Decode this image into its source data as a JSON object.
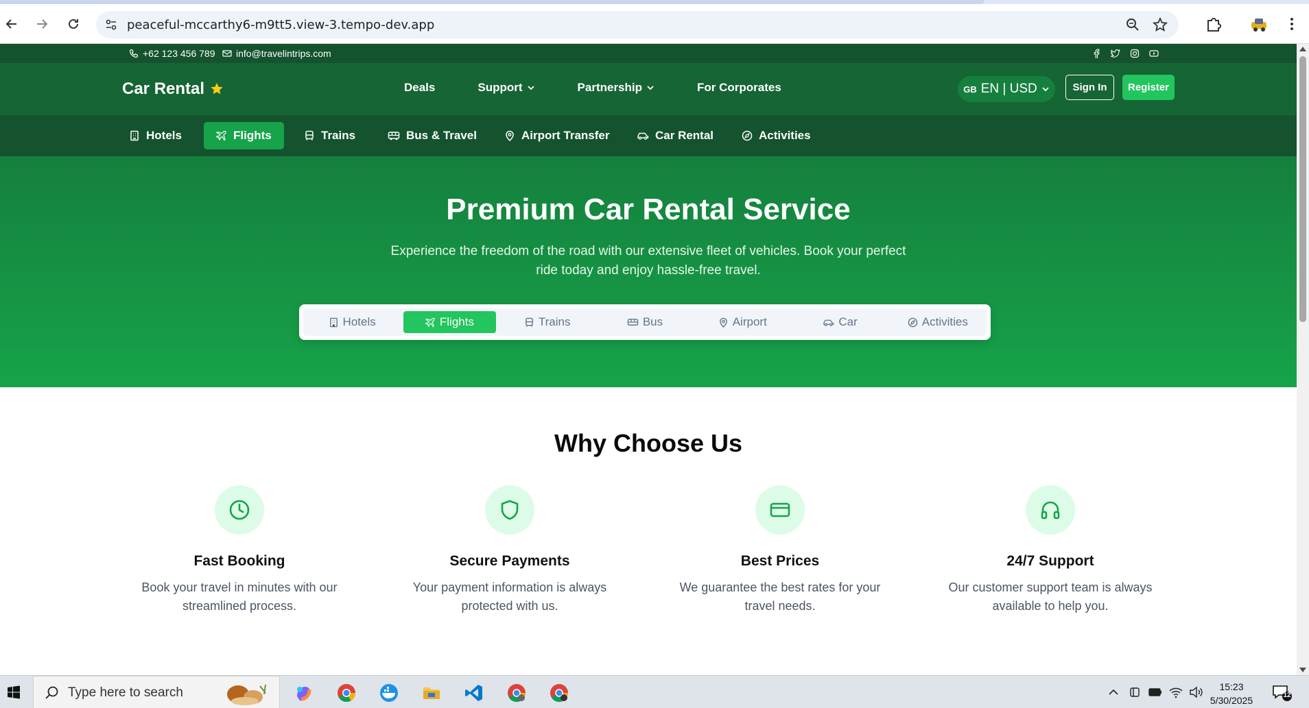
{
  "browser": {
    "url": "peaceful-mccarthy6-m9tt5.view-3.tempo-dev.app"
  },
  "topbar": {
    "phone": "+62 123 456 789",
    "email": "info@travelintrips.com"
  },
  "header": {
    "brand": "Car Rental",
    "nav": [
      {
        "label": "Deals",
        "dropdown": false
      },
      {
        "label": "Support",
        "dropdown": true
      },
      {
        "label": "Partnership",
        "dropdown": true
      },
      {
        "label": "For Corporates",
        "dropdown": false
      }
    ],
    "lang_flag": "GB",
    "lang_label": "EN | USD",
    "signin": "Sign In",
    "register": "Register"
  },
  "categories": [
    {
      "label": "Hotels",
      "icon": "building-icon",
      "active": false
    },
    {
      "label": "Flights",
      "icon": "plane-icon",
      "active": true
    },
    {
      "label": "Trains",
      "icon": "train-icon",
      "active": false
    },
    {
      "label": "Bus & Travel",
      "icon": "bus-icon",
      "active": false
    },
    {
      "label": "Airport Transfer",
      "icon": "map-pin-icon",
      "active": false
    },
    {
      "label": "Car Rental",
      "icon": "car-icon",
      "active": false
    },
    {
      "label": "Activities",
      "icon": "compass-icon",
      "active": false
    }
  ],
  "hero": {
    "title": "Premium Car Rental Service",
    "subtitle": "Experience the freedom of the road with our extensive fleet of vehicles. Book your perfect ride today and enjoy hassle-free travel.",
    "tabs": [
      {
        "label": "Hotels",
        "icon": "building-icon",
        "active": false
      },
      {
        "label": "Flights",
        "icon": "plane-icon",
        "active": true
      },
      {
        "label": "Trains",
        "icon": "train-icon",
        "active": false
      },
      {
        "label": "Bus",
        "icon": "bus-icon",
        "active": false
      },
      {
        "label": "Airport",
        "icon": "map-pin-icon",
        "active": false
      },
      {
        "label": "Car",
        "icon": "car-icon",
        "active": false
      },
      {
        "label": "Activities",
        "icon": "compass-icon",
        "active": false
      }
    ]
  },
  "why": {
    "title": "Why Choose Us",
    "features": [
      {
        "title": "Fast Booking",
        "text": "Book your travel in minutes with our streamlined process.",
        "icon": "clock-icon"
      },
      {
        "title": "Secure Payments",
        "text": "Your payment information is always protected with us.",
        "icon": "shield-icon"
      },
      {
        "title": "Best Prices",
        "text": "We guarantee the best rates for your travel needs.",
        "icon": "credit-card-icon"
      },
      {
        "title": "24/7 Support",
        "text": "Our customer support team is always available to help you.",
        "icon": "headphones-icon"
      }
    ]
  },
  "taskbar": {
    "search_placeholder": "Type here to search",
    "time": "15:23",
    "date": "5/30/2025",
    "notifications": "12"
  },
  "colors": {
    "topbar": "#14532d",
    "nav": "#166534",
    "accent": "#22c55e",
    "hero_top": "#15803d",
    "hero_bottom": "#16a34a",
    "feature_circle": "#dcfce7"
  }
}
